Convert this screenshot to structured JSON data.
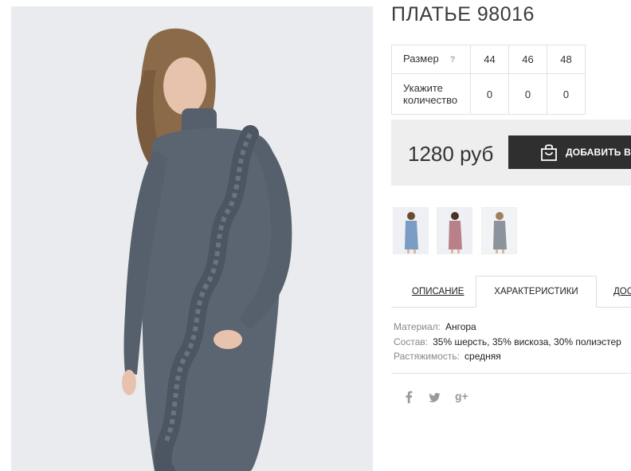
{
  "product": {
    "title": "ПЛАТЬЕ 98016",
    "main_image_alt": "product-photo-dress"
  },
  "size_table": {
    "size_label": "Размер",
    "help_label": "?",
    "sizes": [
      "44",
      "46",
      "48"
    ],
    "qty_label_line1": "Укажите",
    "qty_label_line2": "количество",
    "quantities": [
      "0",
      "0",
      "0"
    ]
  },
  "purchase": {
    "price": "1280 руб",
    "add_to_cart_label": "ДОБАВИТЬ В ЗАКАЗ"
  },
  "color_variants": [
    "blue",
    "pink",
    "grey"
  ],
  "tabs": [
    {
      "label": "ОПИСАНИЕ",
      "active": false
    },
    {
      "label": "ХАРАКТЕРИСТИКИ",
      "active": true
    },
    {
      "label": "ДОСТАВКА",
      "active": false
    }
  ],
  "specs": [
    {
      "key": "Материал:",
      "value": "Ангора"
    },
    {
      "key": "Состав:",
      "value": "35% шерсть, 35% вискоза, 30% полиэстер"
    },
    {
      "key": "Растяжимость:",
      "value": "средняя"
    }
  ],
  "social": {
    "facebook": "f",
    "twitter": "t",
    "googleplus": "g+"
  },
  "colors": {
    "dress": "#5a6370",
    "button": "#2f2f2f",
    "price_bg": "#eeeeee"
  }
}
